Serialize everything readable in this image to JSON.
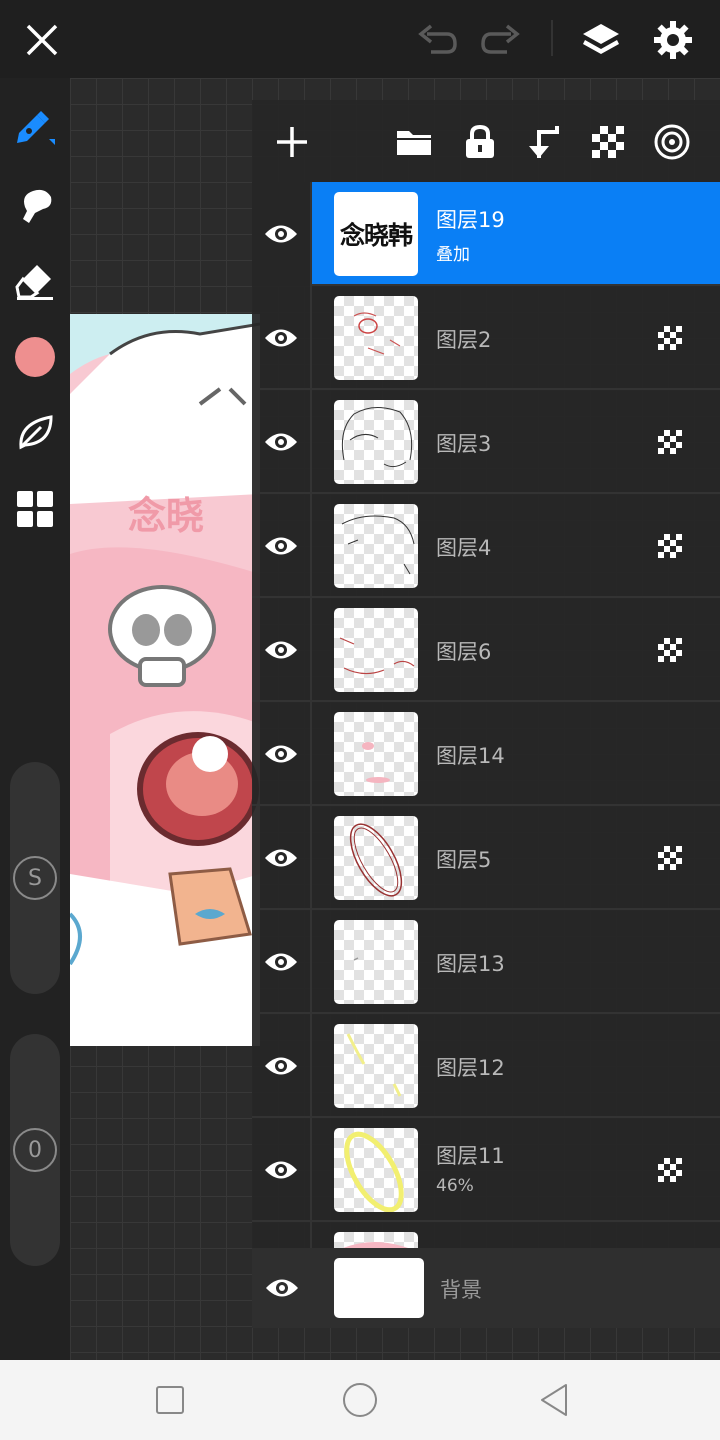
{
  "topbar": {
    "icons": [
      "close-icon",
      "undo-icon",
      "redo-icon",
      "layers-icon",
      "settings-icon"
    ]
  },
  "tools": [
    "pen-icon",
    "smudge-icon",
    "eraser-icon",
    "color-swatch",
    "leaf-icon",
    "grid-icon"
  ],
  "colors": {
    "accent": "#0a7ff5",
    "current_color": "#ee8f8f",
    "panel_bg": "#262626"
  },
  "sliders": {
    "size_label": "S",
    "opacity_label": "0"
  },
  "panel_toolbar": {
    "icons": [
      "add-icon",
      "folder-icon",
      "lock-icon",
      "merge-down-icon",
      "checker-icon",
      "target-icon"
    ]
  },
  "layers": [
    {
      "name": "图层19",
      "sub": "叠加",
      "thumb_text": "念晓韩",
      "selected": true,
      "alpha_lock": false
    },
    {
      "name": "图层2",
      "sub": "",
      "selected": false,
      "alpha_lock": true
    },
    {
      "name": "图层3",
      "sub": "",
      "selected": false,
      "alpha_lock": true
    },
    {
      "name": "图层4",
      "sub": "",
      "selected": false,
      "alpha_lock": true
    },
    {
      "name": "图层6",
      "sub": "",
      "selected": false,
      "alpha_lock": true
    },
    {
      "name": "图层14",
      "sub": "",
      "selected": false,
      "alpha_lock": false
    },
    {
      "name": "图层5",
      "sub": "",
      "selected": false,
      "alpha_lock": true
    },
    {
      "name": "图层13",
      "sub": "",
      "selected": false,
      "alpha_lock": false
    },
    {
      "name": "图层12",
      "sub": "",
      "selected": false,
      "alpha_lock": false
    },
    {
      "name": "图层11",
      "sub": "46%",
      "selected": false,
      "alpha_lock": true
    }
  ],
  "background_layer": {
    "name": "背景"
  },
  "artwork": {
    "stamp_text": "念晓"
  },
  "navbar": {
    "icons": [
      "recents-icon",
      "home-icon",
      "back-icon"
    ]
  }
}
